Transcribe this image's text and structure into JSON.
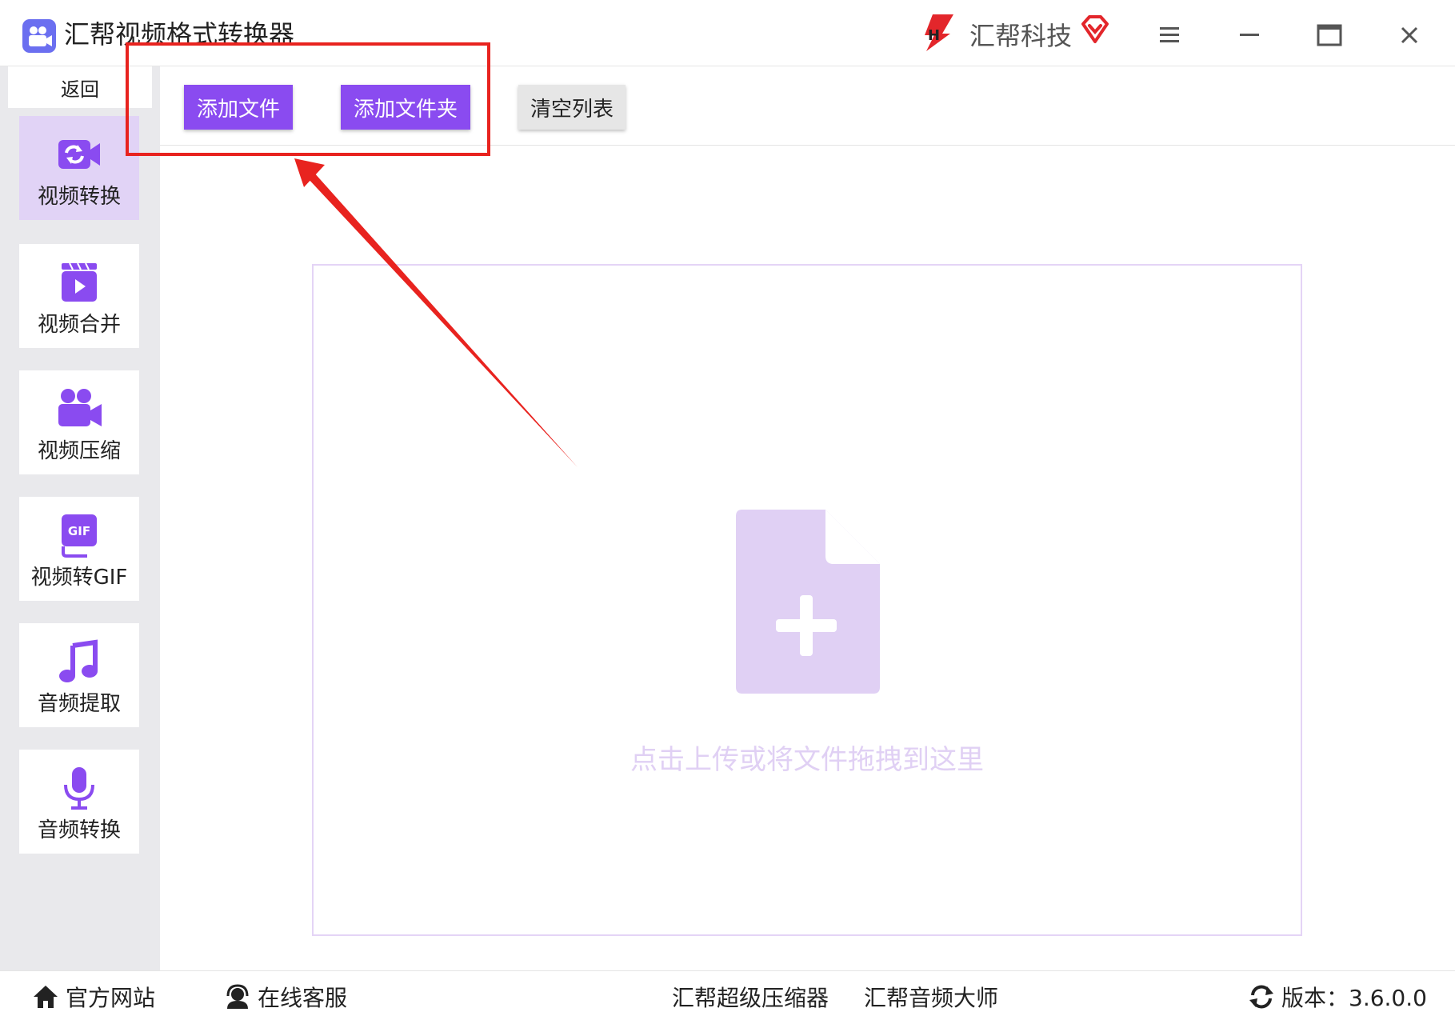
{
  "app": {
    "title": "汇帮视频格式转换器",
    "brand_name": "汇帮科技",
    "icons": {
      "app": "video-camera-app-icon",
      "brand": "huibang-logo-icon",
      "vip": "diamond-vip-icon",
      "menu": "hamburger-menu-icon",
      "minimize": "minimize-icon",
      "maximize": "maximize-icon",
      "close": "close-icon"
    }
  },
  "sidebar": {
    "back_label": "返回",
    "items": [
      {
        "label": "视频转换",
        "icon": "video-convert-icon",
        "active": true
      },
      {
        "label": "视频合并",
        "icon": "video-merge-icon",
        "active": false
      },
      {
        "label": "视频压缩",
        "icon": "video-compress-icon",
        "active": false
      },
      {
        "label": "视频转GIF",
        "icon": "gif-icon",
        "active": false
      },
      {
        "label": "音频提取",
        "icon": "music-note-icon",
        "active": false
      },
      {
        "label": "音频转换",
        "icon": "microphone-icon",
        "active": false
      }
    ]
  },
  "toolbar": {
    "add_file": "添加文件",
    "add_folder": "添加文件夹",
    "clear_list": "清空列表"
  },
  "dropzone": {
    "hint": "点击上传或将文件拖拽到这里",
    "icon": "file-add-icon"
  },
  "footer": {
    "website": "官方网站",
    "online_service": "在线客服",
    "compressor": "汇帮超级压缩器",
    "audio_master": "汇帮音频大师",
    "version": "版本：3.6.0.0",
    "icons": {
      "website": "home-icon",
      "service": "headset-icon",
      "version": "refresh-icon"
    }
  },
  "colors": {
    "accent": "#8a4bf0",
    "active_nav_bg": "#e1d3f6",
    "annotation": "#e8231f",
    "dropzone_icon": "#e0d0f4"
  }
}
